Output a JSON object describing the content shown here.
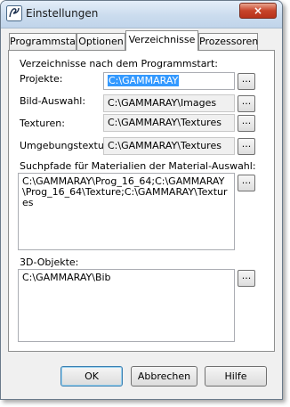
{
  "window": {
    "title": "Einstellungen",
    "close_glyph": "×"
  },
  "tabs": [
    {
      "label": "Programmstart",
      "active": false
    },
    {
      "label": "Optionen",
      "active": false
    },
    {
      "label": "Verzeichnisse",
      "active": true
    },
    {
      "label": "Prozessoren",
      "active": false
    }
  ],
  "panel": {
    "section_heading": "Verzeichnisse nach dem Programmstart:",
    "fields": [
      {
        "label": "Projekte:",
        "value": "C:\\GAMMARAY",
        "selected": true
      },
      {
        "label": "Bild-Auswahl:",
        "value": "C:\\GAMMARAY\\Images"
      },
      {
        "label": "Texturen:",
        "value": "C:\\GAMMARAY\\Textures"
      },
      {
        "label": "Umgebungstextur:",
        "value": "C:\\GAMMARAY\\Textures"
      }
    ],
    "material_label": "Suchpfade für Materialien der Material-Auswahl:",
    "material_value": "C:\\GAMMARAY\\Prog_16_64;C:\\GAMMARAY\\Prog_16_64\\Texture;C:\\GAMMARAY\\Textures",
    "objects_label": "3D-Objekte:",
    "objects_value": "C:\\GAMMARAY\\Bib",
    "browse_label": "..."
  },
  "buttons": {
    "ok": "OK",
    "cancel": "Abbrechen",
    "help": "Hilfe"
  },
  "colors": {
    "selection": "#3399ff",
    "close_button": "#c7442a"
  },
  "icons": {
    "app": "app-logo-icon"
  }
}
